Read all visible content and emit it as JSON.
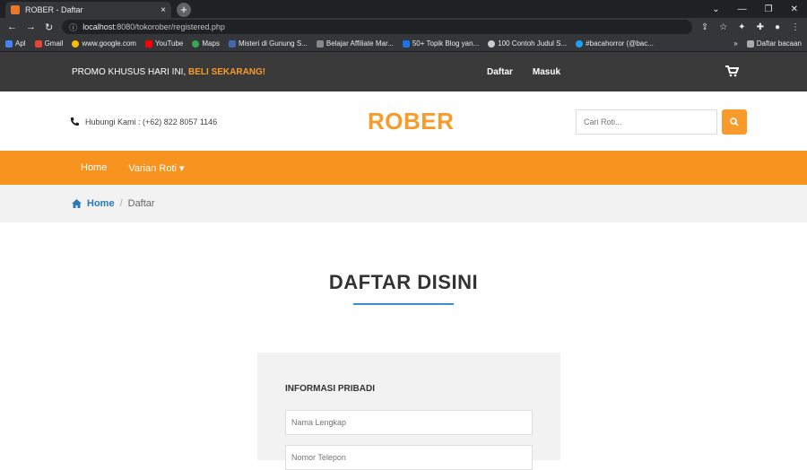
{
  "browser": {
    "tab_title": "ROBER - Daftar",
    "tab_close": "×",
    "new_tab": "+",
    "url_host": "localhost",
    "url_path": ":8080/tokorober/registered.php",
    "window_controls": [
      "⌄",
      "—",
      "❐",
      "✕"
    ],
    "bookmarks": [
      {
        "label": "Apl",
        "color": "#4285f4"
      },
      {
        "label": "Gmail",
        "color": "#ea4335"
      },
      {
        "label": "www.google.com",
        "color": "#fbbc05"
      },
      {
        "label": "YouTube",
        "color": "#ff0000"
      },
      {
        "label": "Maps",
        "color": "#34a853"
      },
      {
        "label": "Misteri di Gunung S...",
        "color": "#4267b2"
      },
      {
        "label": "Belajar Affiliate Mar...",
        "color": "#888888"
      },
      {
        "label": "50+ Topik Blog yan...",
        "color": "#1a73e8"
      },
      {
        "label": "100 Contoh Judul S...",
        "color": "#cccccc"
      },
      {
        "label": "#bacahorror (@bac...",
        "color": "#1da1f2"
      }
    ],
    "bookmarks_more": "»",
    "reading_list": "Daftar bacaan"
  },
  "promo": {
    "text": "PROMO KHUSUS HARI INI, ",
    "highlight": "BELI SEKARANG!",
    "link_daftar": "Daftar",
    "link_masuk": "Masuk",
    "cart_icon": "🛒"
  },
  "header": {
    "phone": "Hubungi Kami : (+62) 822 8057 1146",
    "logo": "ROBER",
    "search_placeholder": "Cari Roti..."
  },
  "nav": {
    "home": "Home",
    "varian": "Varian Roti ▾"
  },
  "breadcrumb": {
    "home": "Home",
    "separator": "/",
    "current": "Daftar"
  },
  "page": {
    "title": "DAFTAR DISINI",
    "section": "INFORMASI PRIBADI",
    "name_placeholder": "Nama Lengkap",
    "phone_placeholder": "Nomor Telepon"
  },
  "colors": {
    "accent": "#f7931e",
    "link": "#2a7ab8",
    "dark_bar": "#3a3a3a"
  }
}
